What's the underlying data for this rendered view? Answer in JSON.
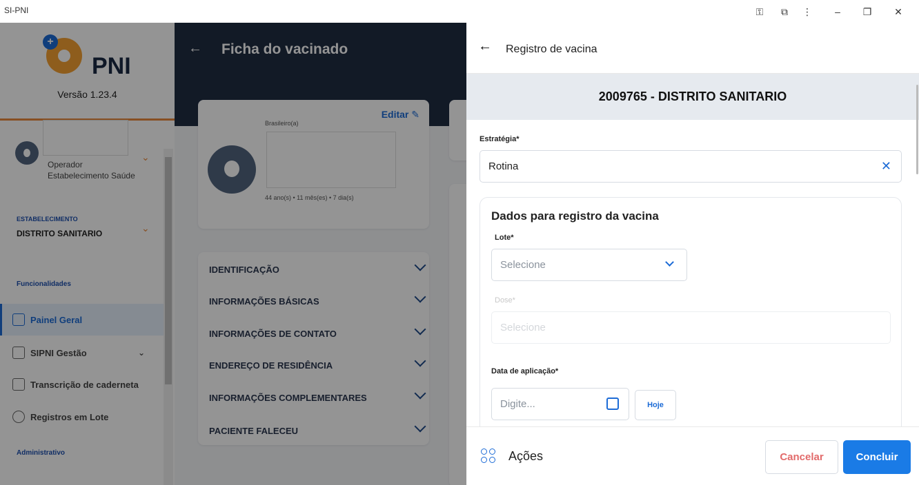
{
  "window": {
    "title": "SI-PNI",
    "controls": [
      "key-icon",
      "extension-icon",
      "more-icon",
      "minimize-icon",
      "restore-icon",
      "close-icon"
    ]
  },
  "sidebar": {
    "logo_text": "PNI",
    "version": "Versão 1.23.4",
    "user_role_1": "Operador",
    "user_role_2": "Estabelecimento Saúde",
    "estab_title": "ESTABELECIMENTO",
    "estab_name": "DISTRITO SANITARIO",
    "section_func": "Funcionalidades",
    "section_admin": "Administrativo",
    "items": [
      {
        "label": "Painel Geral",
        "icon": "monitor-icon"
      },
      {
        "label": "SIPNI Gestão",
        "icon": "clipboard-icon"
      },
      {
        "label": "Transcrição de caderneta",
        "icon": "card-check-icon"
      },
      {
        "label": "Registros em Lote",
        "icon": "syringe-icon"
      }
    ]
  },
  "middle": {
    "title": "Ficha do vacinado",
    "edit_label": "Editar",
    "nationality": "Brasileiro(a)",
    "age": "44 ano(s) • 11 mês(es) • 7 dia(s)",
    "sections": [
      "IDENTIFICAÇÃO",
      "INFORMAÇÕES BÁSICAS",
      "INFORMAÇÕES DE CONTATO",
      "ENDEREÇO DE RESIDÊNCIA",
      "INFORMAÇÕES COMPLEMENTARES",
      "PACIENTE FALECEU"
    ]
  },
  "panel": {
    "title": "Registro de vacina",
    "establishment": "2009765 - DISTRITO SANITARIO",
    "strategy_label": "Estratégia*",
    "strategy_value": "Rotina",
    "card_title": "Dados para registro da vacina",
    "lote_label": "Lote*",
    "lote_placeholder": "Selecione",
    "dose_label": "Dose*",
    "dose_placeholder": "Selecione",
    "date_label": "Data de aplicação*",
    "date_placeholder": "Digite...",
    "today_label": "Hoje",
    "actions_label": "Ações",
    "cancel_label": "Cancelar",
    "confirm_label": "Concluir"
  },
  "colors": {
    "accent": "#1a7be6",
    "brand_orange": "#e8893b",
    "dark_header": "#1f2d43",
    "cancel_red": "#e26a6a"
  }
}
